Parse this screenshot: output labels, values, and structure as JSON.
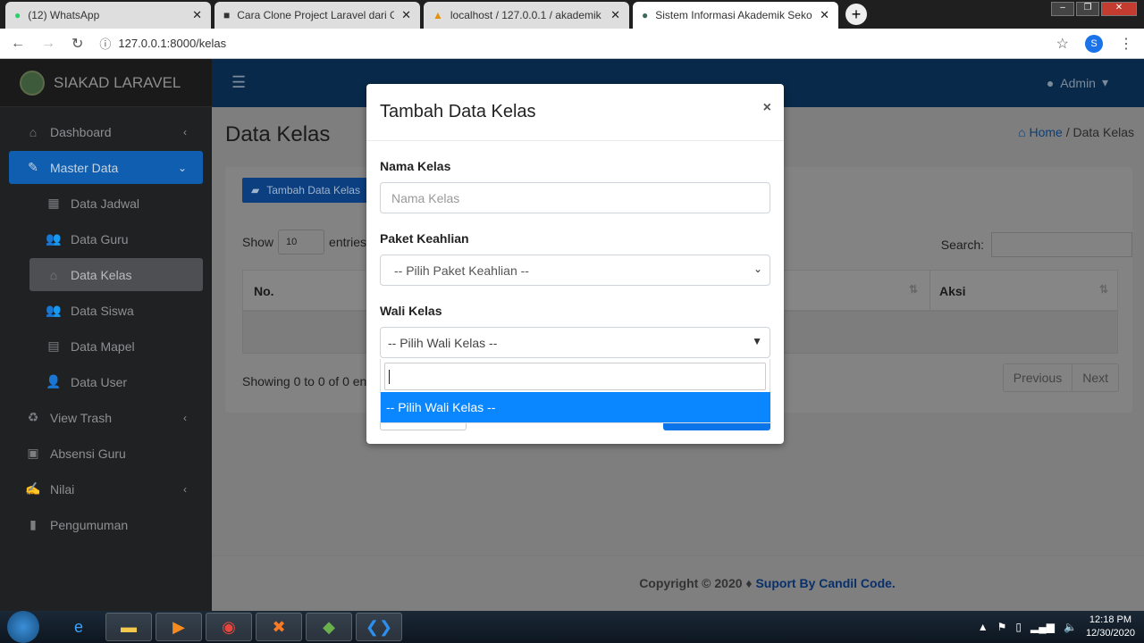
{
  "browser": {
    "tabs": [
      {
        "title": "(12) WhatsApp",
        "icon": "whatsapp-icon"
      },
      {
        "title": "Cara Clone Project Laravel dari G",
        "icon": "video-icon"
      },
      {
        "title": "localhost / 127.0.0.1 / akademik",
        "icon": "phpmyadmin-icon"
      },
      {
        "title": "Sistem Informasi Akademik Sekol",
        "icon": "site-icon",
        "active": true
      }
    ],
    "url": "127.0.0.1:8000/kelas",
    "profile_initial": "S"
  },
  "app": {
    "brand": "SIAKAD LARAVEL",
    "user": "Admin",
    "sidebar": [
      {
        "label": "Dashboard",
        "icon": "tachometer-icon"
      },
      {
        "label": "Master Data",
        "icon": "edit-icon"
      },
      {
        "label": "Data Jadwal",
        "icon": "calendar-icon"
      },
      {
        "label": "Data Guru",
        "icon": "users-icon"
      },
      {
        "label": "Data Kelas",
        "icon": "home-icon"
      },
      {
        "label": "Data Siswa",
        "icon": "users-icon"
      },
      {
        "label": "Data Mapel",
        "icon": "book-icon"
      },
      {
        "label": "Data User",
        "icon": "user-plus-icon"
      },
      {
        "label": "View Trash",
        "icon": "recycle-icon"
      },
      {
        "label": "Absensi Guru",
        "icon": "calendar-check-icon"
      },
      {
        "label": "Nilai",
        "icon": "file-signature-icon"
      },
      {
        "label": "Pengumuman",
        "icon": "clipboard-icon"
      }
    ],
    "page_title": "Data Kelas",
    "breadcrumb": {
      "home": "Home",
      "sep": "/",
      "current": "Data Kelas"
    },
    "add_button": "Tambah Data Kelas",
    "show_label": "Show",
    "entries_value": "10",
    "entries_label": "entries",
    "search_label": "Search:",
    "columns": [
      "No.",
      "Aksi"
    ],
    "info": "Showing 0 to 0 of 0 ent",
    "pagination": [
      "Previous",
      "Next"
    ],
    "footer": {
      "text": "Copyright © 2020 ♦",
      "link": "Suport By Candil Code."
    }
  },
  "modal": {
    "title": "Tambah Data Kelas",
    "close": "×",
    "fields": {
      "nama_label": "Nama Kelas",
      "nama_placeholder": "Nama Kelas",
      "paket_label": "Paket Keahlian",
      "paket_value": "-- Pilih Paket Keahlian --",
      "wali_label": "Wali Kelas",
      "wali_value": "-- Pilih Wali Kelas --"
    },
    "dropdown_options": [
      "-- Pilih Wali Kelas --"
    ]
  },
  "taskbar": {
    "time": "12:18 PM",
    "date": "12/30/2020"
  }
}
